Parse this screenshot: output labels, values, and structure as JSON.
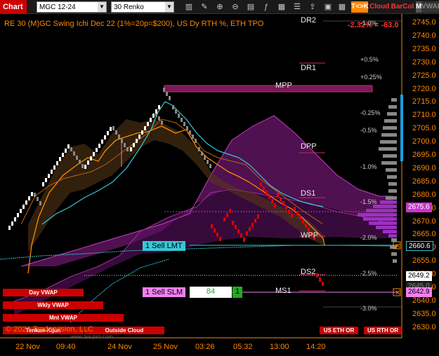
{
  "toolbar": {
    "title": "Chart",
    "symbol": "MGC 12-24",
    "interval": "30 Renko",
    "tk_label": "T<>K",
    "cloud_label": "Cloud",
    "barcol_label": "BarCol",
    "m_label": "M",
    "vwap_label": "VWAP"
  },
  "chart": {
    "header": "RE 30 (M)GC Swing Ichi Dec 22 (1%=20p=$200), US Dy RTH %, ETH TPO",
    "change_text": "-2.32% = -63.0",
    "copyright": "© 2024 Tradervision, LLC",
    "website": "www.tss-pro.com",
    "price_axis": [
      "2745.0",
      "2740.0",
      "2735.0",
      "2730.0",
      "2725.0",
      "2720.0",
      "2715.0",
      "2710.0",
      "2705.0",
      "2700.0",
      "2695.0",
      "2690.0",
      "2685.0",
      "2680.0",
      "2675.0",
      "2670.0",
      "2665.0",
      "2660.0",
      "2655.0",
      "2650.0",
      "2645.0",
      "2640.0",
      "2635.0",
      "2630.0"
    ],
    "time_axis": [
      "22 Nov",
      "09:40",
      "24 Nov",
      "25 Nov",
      "03:26",
      "05:32",
      "13:00",
      "14:20"
    ],
    "levels": {
      "dr2": "DR2",
      "dr1": "DR1",
      "mpp": "MPP",
      "dpp": "DPP",
      "ds1": "DS1",
      "wpp": "WPP",
      "ds2": "DS2",
      "ms1": "MS1"
    },
    "pct_levels": [
      "-1.0%",
      "+0.5%",
      "+0.25%",
      "-0.25%",
      "-0.5%",
      "-1.0%",
      "-1.5%",
      "-2.0%",
      "-2.5%",
      "-3.0%"
    ],
    "price_boxes": {
      "p1": "2675.6",
      "p2": "2660.6",
      "p3": "2649.2",
      "p4": "2645.0",
      "p5": "2642.9"
    },
    "orders": {
      "sell_lmt": "1 Sell LMT",
      "sell_slm": "1 Sell SLM",
      "qty": "84",
      "qty_one": "1"
    },
    "buttons": {
      "day_vwap": "Day VWAP",
      "wkly_vwap": "Wkly VWAP",
      "mnt_vwap": "Mnt VWAP",
      "tenkan_kijun": "Tenkan-Kijun",
      "outside_cloud": "Outside Cloud",
      "us_eth_or": "US ETH OR",
      "us_rth_or": "US RTH OR"
    },
    "colors": {
      "axis": "#ff8800",
      "cloud": "#8b1a8b",
      "tenkan": "#ff8800",
      "kijun": "#36c8d8",
      "renko_up": "#ffffff",
      "renko_down": "#e00000"
    }
  }
}
